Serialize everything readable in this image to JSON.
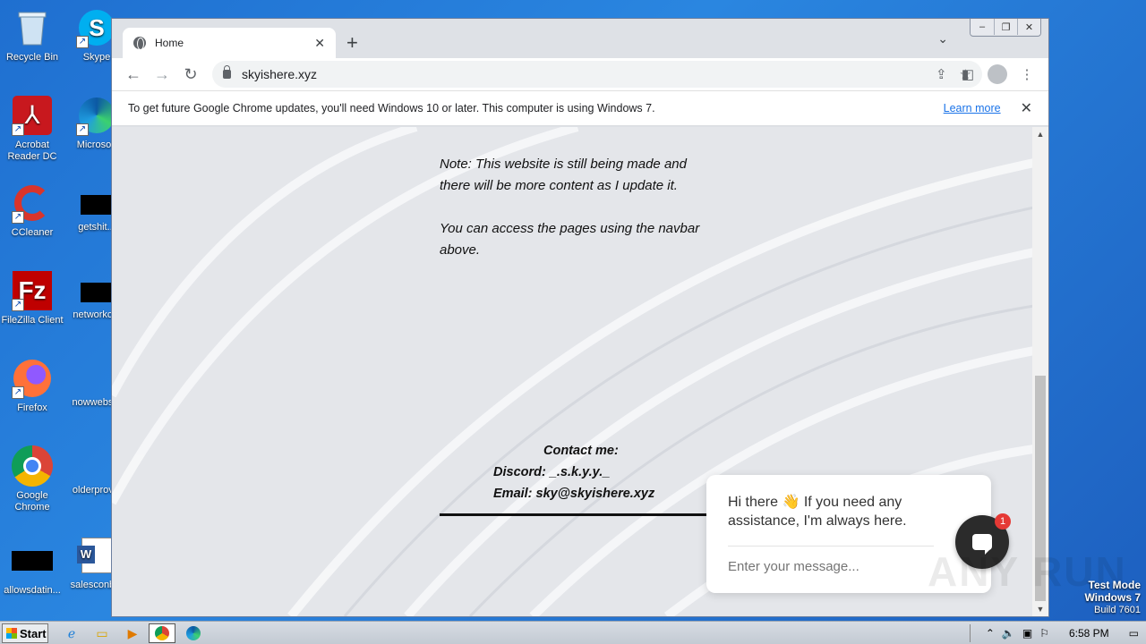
{
  "desktop": {
    "icons_col1": [
      "Recycle Bin",
      "Acrobat Reader DC",
      "CCleaner",
      "FileZilla Client",
      "Firefox",
      "Google Chrome",
      "allowsdatin..."
    ],
    "icons_col2": [
      "Skype",
      "Microsoft",
      "getshit...",
      "networkc...",
      "nowwebs...",
      "olderprov...",
      "salesconb..."
    ]
  },
  "browser": {
    "tab_title": "Home",
    "url": "skyishere.xyz",
    "window_controls": [
      "–",
      "❐",
      "✕"
    ],
    "infobar": {
      "message": "To get future Google Chrome updates, you'll need Windows 10 or later. This computer is using Windows 7.",
      "link": "Learn more"
    }
  },
  "page": {
    "note_p1": "Note: This website is still being made and there will be more content as I update it.",
    "note_p2": "You can access the pages using the navbar above.",
    "contact_heading": "Contact me:",
    "discord": "Discord: _.s.k.y.y._",
    "email": "Email: sky@skyishere.xyz"
  },
  "chat": {
    "greeting": "Hi there 👋 If you need any assistance, I'm always here.",
    "placeholder": "Enter your message...",
    "badge": "1"
  },
  "watermark": "ANY RUN",
  "system": {
    "test_mode": "Test Mode",
    "os": "Windows 7",
    "build": "Build 7601",
    "start": "Start",
    "clock": "6:58 PM"
  }
}
